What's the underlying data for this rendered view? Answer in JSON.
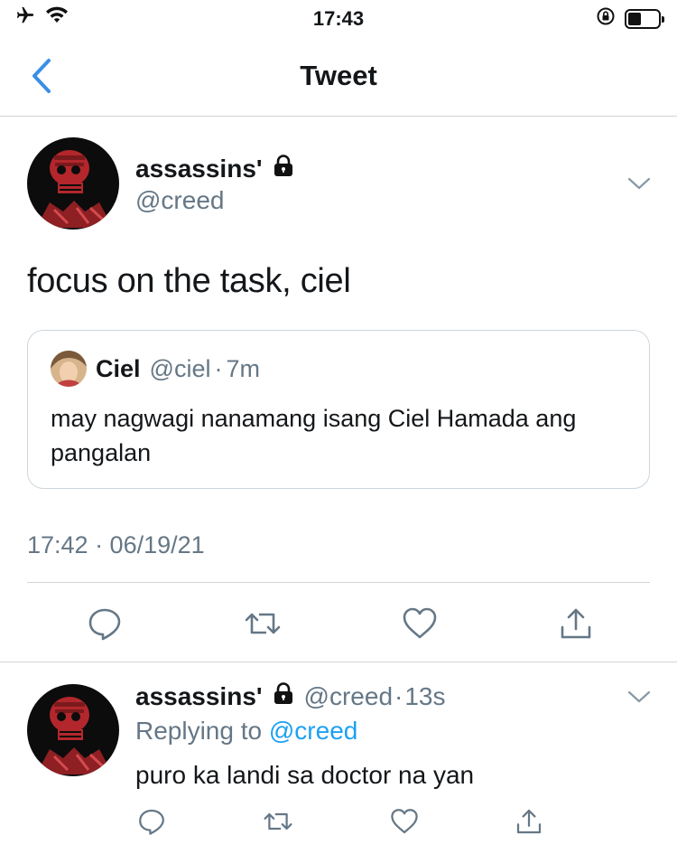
{
  "status_bar": {
    "time": "17:43"
  },
  "nav": {
    "title": "Tweet"
  },
  "tweet": {
    "author_name": "assassins'",
    "author_handle": "@creed",
    "text": "focus on the task, ciel",
    "quote": {
      "name": "Ciel",
      "handle": "@ciel",
      "separator": "·",
      "time_ago": "7m",
      "text": "may nagwagi nanamang isang Ciel Hamada ang pangalan"
    },
    "timestamp": "17:42 · 06/19/21"
  },
  "reply": {
    "author_name": "assassins'",
    "author_handle": "@creed",
    "separator": "·",
    "time_ago": "13s",
    "replying_prefix": "Replying to",
    "replying_to": "@creed",
    "text": "puro ka landi sa doctor na yan"
  },
  "colors": {
    "accent": "#1da1f2",
    "back_arrow": "#3a8ee6",
    "secondary_text": "#657786",
    "divider": "#d0d4d8",
    "avatar_red": "#b3272c"
  },
  "icons": {
    "reply": "speech-bubble-icon",
    "retweet": "retweet-icon",
    "like": "heart-icon",
    "share": "share-icon",
    "lock": "lock-icon"
  }
}
